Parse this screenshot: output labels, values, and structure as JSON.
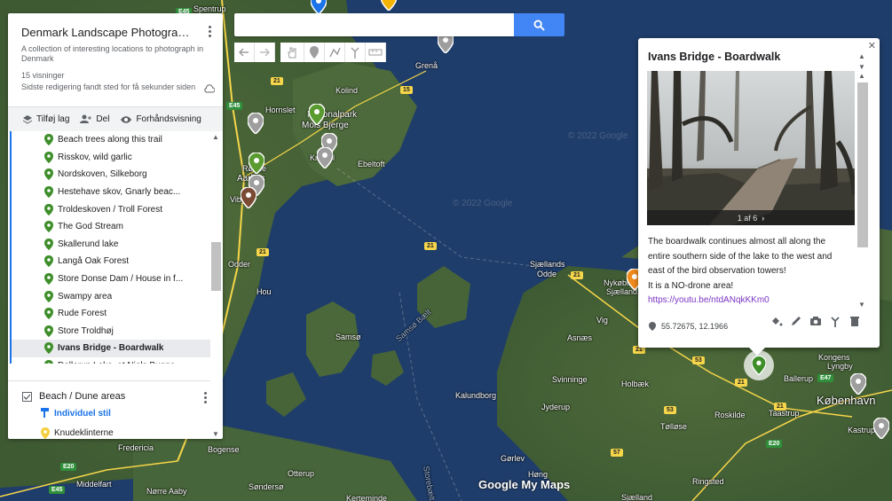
{
  "panel": {
    "title": "Denmark Landscape Photography...",
    "description": "A collection of interesting locations to photograph in Denmark",
    "views": "15 visninger",
    "last_edited": "Sidste redigering fandt sted for få sekunder siden",
    "toolbar": {
      "add_layer": "Tilføj lag",
      "share": "Del",
      "preview": "Forhåndsvisning"
    },
    "layer_items": [
      {
        "label": "Beach trees along this trail"
      },
      {
        "label": "Risskov, wild garlic"
      },
      {
        "label": "Nordskoven, Silkeborg"
      },
      {
        "label": "Hestehave skov, Gnarly beac..."
      },
      {
        "label": "Troldeskoven / Troll Forest"
      },
      {
        "label": "The God Stream"
      },
      {
        "label": "Skallerund lake"
      },
      {
        "label": "Langå Oak Forest"
      },
      {
        "label": "Store Donse Dam / House in f..."
      },
      {
        "label": "Swampy area"
      },
      {
        "label": "Rude Forest"
      },
      {
        "label": "Store Troldhøj"
      },
      {
        "label": "Ivans Bridge - Boardwalk",
        "selected": true
      },
      {
        "label": "Dollerup Lake, at Niels Bugge..."
      }
    ],
    "beach_layer": {
      "name": "Beach / Dune areas",
      "style_link": "Individuel stil",
      "first_item": "Knudeklinterne"
    }
  },
  "info_card": {
    "title": "Ivans Bridge - Boardwalk",
    "photo_counter": "1 af 6",
    "description_lines": [
      "The boardwalk continues almost all along the entire southern side of the lake to the west and east of the bird observation towers!",
      "It is a NO-drone area!"
    ],
    "link": "https://youtu.be/ntdANqkKKm0",
    "coordinates": "55.72675, 12.1966"
  },
  "map_places": [
    {
      "name": "Spentrup"
    },
    {
      "name": "Grenå"
    },
    {
      "name": "Kolind"
    },
    {
      "name": "Hornslet"
    },
    {
      "name": "Nationalpark"
    },
    {
      "name": "Mols Bjerge"
    },
    {
      "name": "Knebel"
    },
    {
      "name": "Ebeltoft"
    },
    {
      "name": "Rønde"
    },
    {
      "name": "Aarhus"
    },
    {
      "name": "Viby"
    },
    {
      "name": "Odder"
    },
    {
      "name": "Hou"
    },
    {
      "name": "Samsø"
    },
    {
      "name": "Samsø Bælt"
    },
    {
      "name": "Sjællands"
    },
    {
      "name": "Odde"
    },
    {
      "name": "Nykøbing"
    },
    {
      "name": "Sjælland"
    },
    {
      "name": "Vig"
    },
    {
      "name": "Asnæs"
    },
    {
      "name": "Hundested"
    },
    {
      "name": "Holbæk"
    },
    {
      "name": "Svinninge"
    },
    {
      "name": "Jyderup"
    },
    {
      "name": "Kalundborg"
    },
    {
      "name": "Roskilde"
    },
    {
      "name": "Taastrup"
    },
    {
      "name": "Ballerup"
    },
    {
      "name": "København"
    },
    {
      "name": "Kongens"
    },
    {
      "name": "Lyngby"
    },
    {
      "name": "Kastrup"
    },
    {
      "name": "Tølløse"
    },
    {
      "name": "Gørlev"
    },
    {
      "name": "Høng"
    },
    {
      "name": "Fredericia"
    },
    {
      "name": "Bogense"
    },
    {
      "name": "Otterup"
    },
    {
      "name": "Middelfart"
    },
    {
      "name": "Nørre Aaby"
    },
    {
      "name": "Søndersø"
    },
    {
      "name": "Kerteminde"
    },
    {
      "name": "Sjælland"
    },
    {
      "name": "Ringsted"
    },
    {
      "name": "Storebælt"
    }
  ],
  "road_labels": [
    "E45",
    "21",
    "15",
    "E45",
    "21",
    "21",
    "21",
    "21",
    "53",
    "53",
    "E47",
    "21",
    "21",
    "E20",
    "57",
    "E45",
    "E20",
    "E20",
    "14",
    "21",
    "E20",
    "E47"
  ],
  "watermarks": [
    "© 2022 Google",
    "© 2022 Google"
  ],
  "branding": "Google My Maps"
}
